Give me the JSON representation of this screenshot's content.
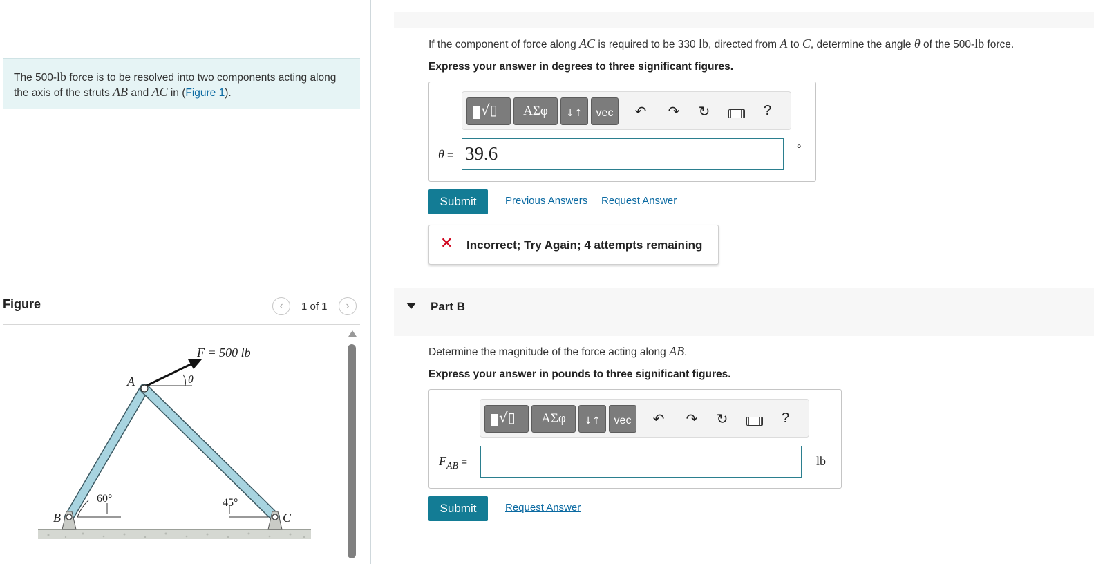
{
  "intro": {
    "text_pre": "The 500-",
    "unit_lb": "lb",
    "text_mid": " force is to be resolved into two components acting along the axis of the struts ",
    "ab": "AB",
    "and": " and ",
    "ac": "AC",
    "in": " in (",
    "figure_link": "Figure 1",
    "close": ")."
  },
  "figure_panel": {
    "title": "Figure",
    "count": "1 of 1",
    "prev_icon": "chevron-left-icon",
    "next_icon": "chevron-right-icon",
    "labels": {
      "force": "F = 500 lb",
      "theta": "θ",
      "a": "A",
      "b": "B",
      "c": "C",
      "angle_b": "60°",
      "angle_c": "45°"
    }
  },
  "part_a": {
    "question_pre": "If the component of force along ",
    "ac": "AC",
    "q2": " is required to be 330 ",
    "lb": "lb",
    "q3": ", directed from ",
    "a": "A",
    "to": " to ",
    "c": "C",
    "q4": ", determine the angle ",
    "theta": "θ",
    "q5": " of the 500-",
    "lb2": "lb",
    "q6": " force.",
    "instruction": "Express your answer in degrees to three significant figures.",
    "eq_label": "θ",
    "eq_equals": " =",
    "answer_value": "39.6",
    "unit": "°",
    "submit_label": "Submit",
    "previous_answers": "Previous Answers",
    "request_answer": "Request Answer",
    "feedback_icon": "✕",
    "feedback_text": "Incorrect; Try Again; 4 attempts remaining"
  },
  "part_b": {
    "title": "Part B",
    "question_pre": "Determine the magnitude of the force acting along ",
    "ab": "AB",
    "q2": ".",
    "instruction": "Express your answer in pounds to three significant figures.",
    "eq_label": "F",
    "eq_sub": "AB",
    "eq_equals": " =",
    "answer_value": "",
    "unit": "lb",
    "submit_label": "Submit",
    "request_answer": "Request Answer"
  },
  "toolbar": {
    "greek_label": "ΑΣφ",
    "arrows_label": "↓↑",
    "vec_label": "vec",
    "help_label": "?",
    "icons": [
      "templates-icon",
      "greek-icon",
      "arrows-icon",
      "vec-icon",
      "undo-icon",
      "redo-icon",
      "reset-icon",
      "keyboard-icon",
      "help-icon"
    ]
  },
  "colors": {
    "intro_bg": "#e6f4f5",
    "submit_bg": "#137c95",
    "link": "#0b6aa2",
    "error": "#d0021b",
    "strut": "#a8d4e0"
  }
}
